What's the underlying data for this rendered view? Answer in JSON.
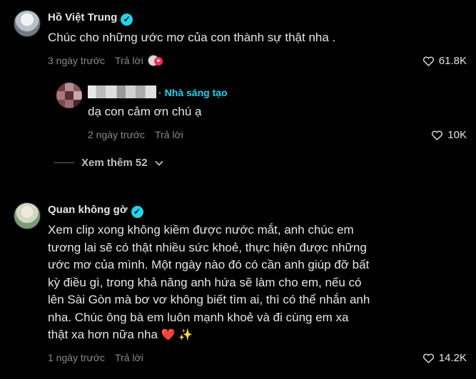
{
  "comments": [
    {
      "username": "Hồ Việt Trung",
      "text": "Chúc cho những ước mơ của con thành sự thật nha .",
      "time": "3 ngày trước",
      "reply_label": "Trả lời",
      "likes": "61.8K",
      "reply": {
        "creator_label": "Nhà sáng tạo",
        "text": "dạ con cảm ơn chú ạ",
        "time": "2 ngày trước",
        "reply_label": "Trả lời",
        "likes": "10K"
      },
      "view_more": "Xem thêm 52"
    },
    {
      "username": "Quan không gờ",
      "lines": [
        "Xem clip xong không kiềm được nước mắt, anh chúc em",
        "tương lai sẽ có thật nhiều sức khoẻ, thực hiện được những",
        "ước mơ của mình. Một ngày nào đó có cần anh giúp đỡ bất",
        "kỳ điều gì, trong khả năng anh hứa sẽ làm cho em, nếu có",
        "lên Sài Gòn mà bơ vơ không biết tìm ai, thì có thể nhắn anh",
        "nha. Chúc ông bà em luôn mạnh khoẻ và đi cùng em xa",
        "thật xa hơn nữa nha"
      ],
      "emoji": [
        "❤️",
        "✨"
      ],
      "time": "1 ngày trước",
      "reply_label": "Trả lời",
      "likes": "14.2K"
    }
  ],
  "icons": {
    "verified": "verified-badge-icon",
    "like": "heart-outline-icon",
    "reaction": "creator-liked-icon",
    "expand": "chevron-down-icon"
  },
  "colors": {
    "background": "#000000",
    "verified": "#20d5ec",
    "creator_tag": "#20d5ec",
    "meta_text": "#8a8a8a",
    "heart_emoji": "#e41e3f"
  }
}
